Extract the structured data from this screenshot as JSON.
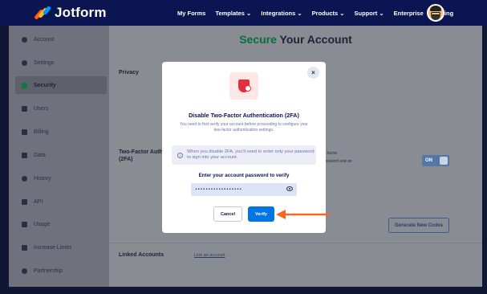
{
  "brand": {
    "name": "Jotform"
  },
  "nav": [
    "My Forms",
    "Templates ⌄",
    "Integrations ⌄",
    "Products ⌄",
    "Support ⌄",
    "Enterprise",
    "Pricing"
  ],
  "sidebar": {
    "items": [
      {
        "label": "Account",
        "icon": "user-icon"
      },
      {
        "label": "Settings",
        "icon": "gear-icon"
      },
      {
        "label": "Security",
        "icon": "lock-icon",
        "active": true
      },
      {
        "label": "Users",
        "icon": "users-icon"
      },
      {
        "label": "Billing",
        "icon": "billing-icon"
      },
      {
        "label": "Data",
        "icon": "data-icon"
      },
      {
        "label": "History",
        "icon": "history-icon"
      },
      {
        "label": "API",
        "icon": "api-icon"
      },
      {
        "label": "Usage",
        "icon": "usage-icon"
      },
      {
        "label": "Increase Limits",
        "icon": "gift-icon"
      },
      {
        "label": "Partnership",
        "icon": "partnership-icon"
      }
    ]
  },
  "page": {
    "title_accent": "Secure",
    "title_rest": " Your Account",
    "privacy_label": "Privacy",
    "tfa_label": "Two-Factor Auth (2FA)",
    "tfa_desc_line1": "-factor",
    "tfa_desc_line2": "ssword and an",
    "toggle_label": "ON",
    "generate_codes_label": "Generate New Codes",
    "linked_accounts_label": "Linked Accounts",
    "link_account_label": "Link an account"
  },
  "modal": {
    "title": "Disable Two-Factor Authentication (2FA)",
    "subtitle": "You need to first verify your account before proceeding to configure your two-factor authentication settings.",
    "info_text": "When you disable 2FA, you'll need to enter only your password to sign into your account.",
    "password_label": "Enter your account password to verify",
    "password_value": "••••••••••••••••••",
    "cancel_label": "Cancel",
    "verify_label": "Verify",
    "close_glyph": "×",
    "info_glyph": "i"
  },
  "colors": {
    "nav_bg": "#0a1551",
    "accent_green": "#06703a",
    "verify_blue": "#0075e3",
    "arrow_orange": "#f26a21",
    "danger_red": "#e52e3a"
  }
}
